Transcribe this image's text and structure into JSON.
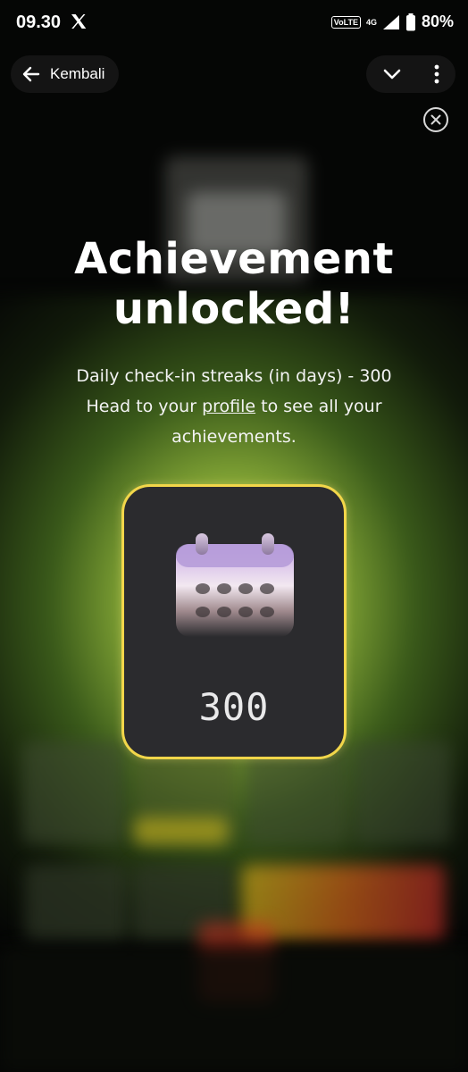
{
  "status_bar": {
    "time": "09.30",
    "volte": "VoLTE",
    "network": "4G",
    "battery": "80%"
  },
  "top_bar": {
    "back_label": "Kembali"
  },
  "achievement": {
    "title_line1": "Achievement",
    "title_line2": "unlocked!",
    "line1": "Daily check-in streaks (in days) - 300",
    "line2_pre": "Head to your ",
    "line2_link": "profile",
    "line2_post": " to see all your",
    "line3": "achievements.",
    "badge_value": "300"
  },
  "icons": {
    "x_logo": "x-logo-icon",
    "signal": "signal-icon",
    "battery": "battery-icon",
    "back": "arrow-left-icon",
    "chevron": "chevron-down-icon",
    "more": "more-vertical-icon",
    "close": "close-circle-icon",
    "badge": "calendar-icon"
  },
  "colors": {
    "badge_border": "#f2d64a",
    "badge_bg": "#2b2b2e",
    "glow": "#dfe98a"
  }
}
